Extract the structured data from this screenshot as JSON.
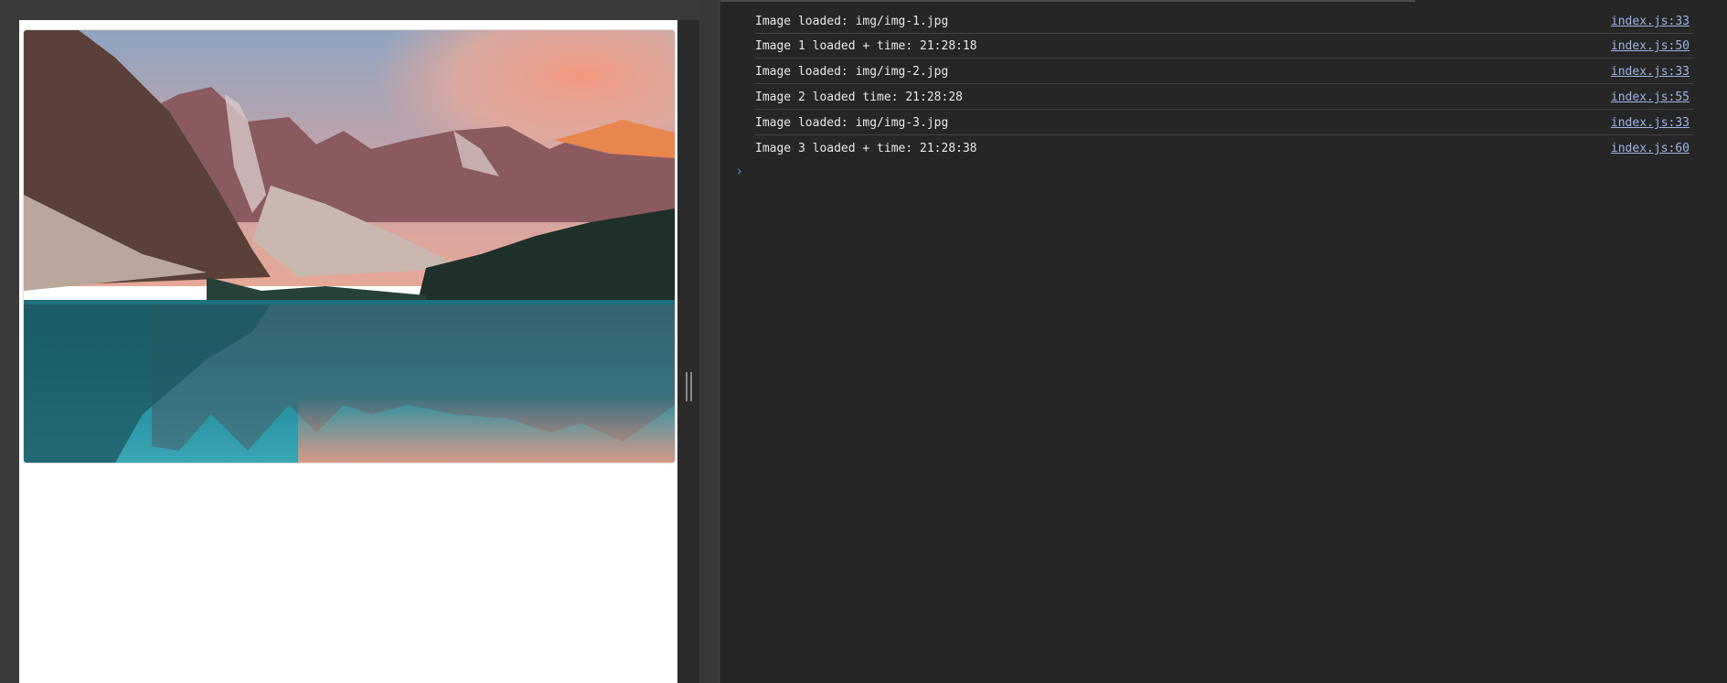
{
  "console": {
    "messages": [
      {
        "text": "Image loaded: img/img-1.jpg",
        "source": "index.js:33"
      },
      {
        "text": "Image 1 loaded + time: 21:28:18",
        "source": "index.js:50"
      },
      {
        "text": "Image loaded: img/img-2.jpg",
        "source": "index.js:33"
      },
      {
        "text": "Image 2 loaded time: 21:28:28",
        "source": "index.js:55"
      },
      {
        "text": "Image loaded: img/img-3.jpg",
        "source": "index.js:33"
      },
      {
        "text": "Image 3 loaded + time: 21:28:38",
        "source": "index.js:60"
      }
    ],
    "prompt_icon": "chevron-right-icon"
  },
  "viewport": {
    "image_subject": "mountain-lake-photo"
  }
}
